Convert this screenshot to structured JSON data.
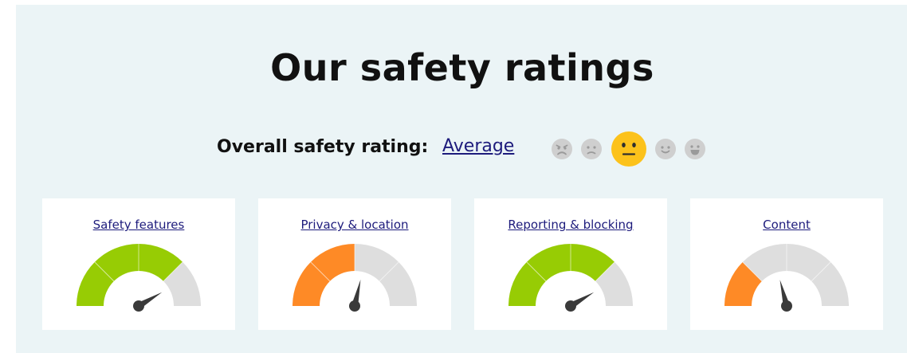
{
  "heading": "Our safety ratings",
  "overall": {
    "label": "Overall safety rating:",
    "value": "Average",
    "faces": [
      "very-poor-face-icon",
      "poor-face-icon",
      "average-face-icon",
      "good-face-icon",
      "very-good-face-icon"
    ],
    "selected_index": 2
  },
  "categories": [
    {
      "label": "Safety features",
      "level": 3,
      "of": 4,
      "color": "#97cc04",
      "needle_fraction": 0.83
    },
    {
      "label": "Privacy & location",
      "level": 2,
      "of": 4,
      "color": "#fe8a26",
      "needle_fraction": 0.57
    },
    {
      "label": "Reporting & blocking",
      "level": 3,
      "of": 4,
      "color": "#97cc04",
      "needle_fraction": 0.83
    },
    {
      "label": "Content",
      "level": 1,
      "of": 4,
      "color": "#fe8a26",
      "needle_fraction": 0.42
    }
  ],
  "colors": {
    "background": "#ebf4f6",
    "link": "#1d1b7c",
    "gauge_inactive": "#dedede",
    "needle": "#3a3a3a",
    "face_inactive": "#cfcfcf",
    "face_active": "#fcc21b"
  }
}
